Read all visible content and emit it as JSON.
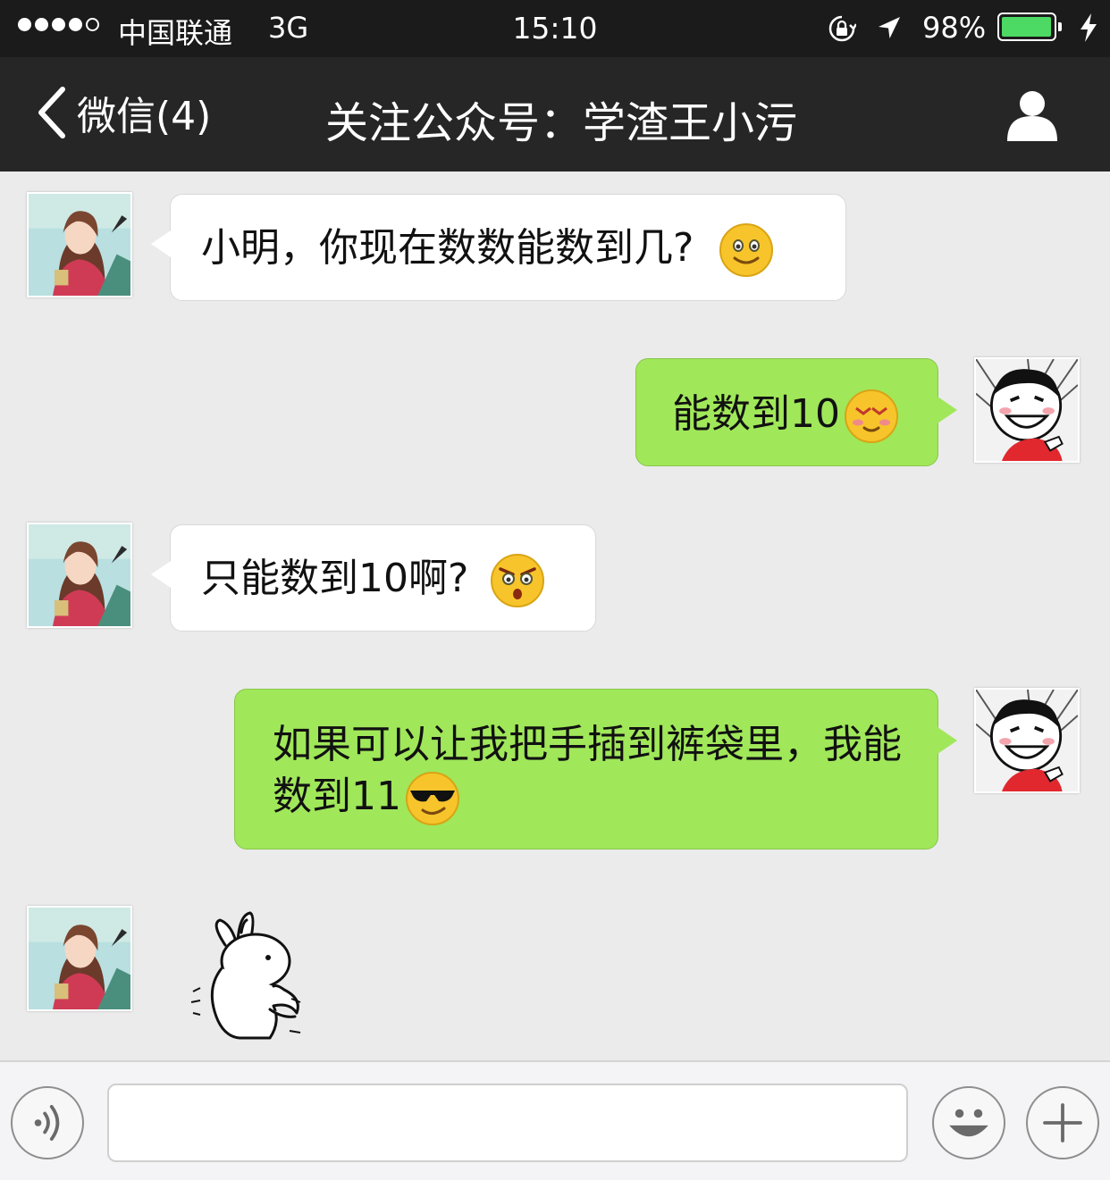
{
  "status_bar": {
    "carrier": "中国联通",
    "network": "3G",
    "time": "15:10",
    "battery_percent": "98%",
    "battery_level": 0.98,
    "signal_bars": 4,
    "signal_max": 5
  },
  "nav": {
    "back_label": "微信(4)",
    "title": "关注公众号：学渣王小污",
    "profile_icon": "person-icon"
  },
  "messages": [
    {
      "side": "in",
      "text": "小明，你现在数数能数到几?",
      "emoji": "smile-emoji"
    },
    {
      "side": "out",
      "text": "能数到10",
      "emoji": "blush-emoji"
    },
    {
      "side": "in",
      "text": "只能数到10啊?",
      "emoji": "angry-shocked-emoji"
    },
    {
      "side": "out",
      "text": "如果可以让我把手插到裤袋里，我能数到11",
      "emoji": "sunglasses-emoji"
    },
    {
      "side": "in",
      "sticker": "rabbit-middle-finger-sticker"
    }
  ],
  "input_bar": {
    "voice_icon": "voice-icon",
    "text_value": "",
    "emoji_icon": "emoji-icon",
    "plus_icon": "plus-icon"
  },
  "colors": {
    "outgoing_bubble": "#a0e75a",
    "incoming_bubble": "#ffffff",
    "chat_background": "#ebebeb",
    "nav_background": "#262626"
  }
}
